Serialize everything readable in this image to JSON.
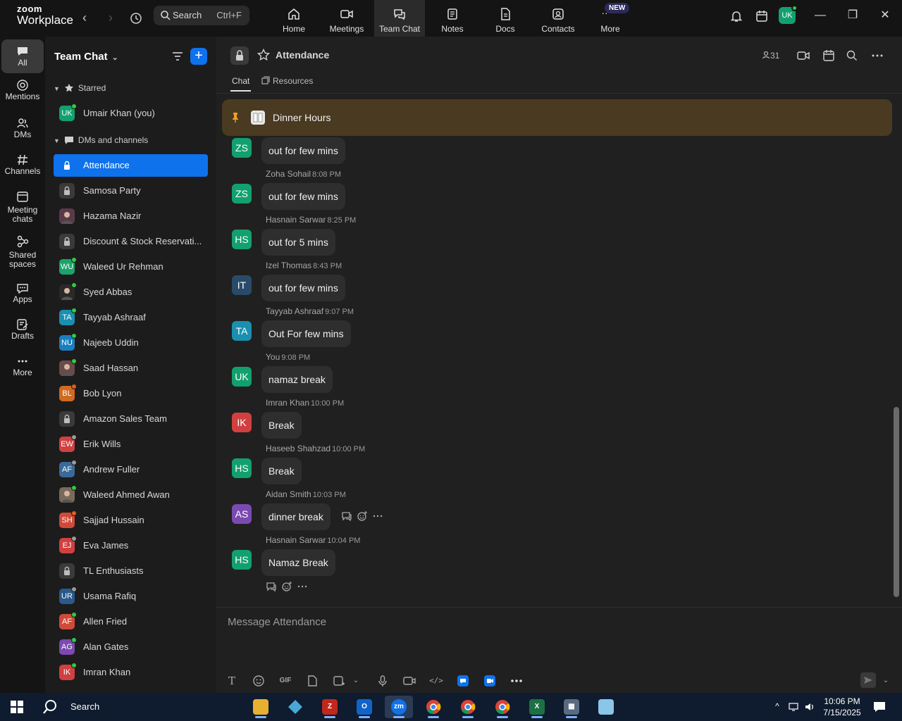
{
  "app": {
    "logo_top": "zoom",
    "logo_bottom": "Workplace"
  },
  "topbar": {
    "search_label": "Search",
    "search_shortcut": "Ctrl+F",
    "tabs": [
      {
        "label": "Home",
        "icon": "home-icon"
      },
      {
        "label": "Meetings",
        "icon": "video-icon"
      },
      {
        "label": "Team Chat",
        "icon": "chat-icon",
        "active": true
      },
      {
        "label": "Notes",
        "icon": "notes-icon"
      },
      {
        "label": "Docs",
        "icon": "docs-icon"
      },
      {
        "label": "Contacts",
        "icon": "contacts-icon"
      },
      {
        "label": "More",
        "icon": "more-icon"
      }
    ],
    "new_badge": "NEW",
    "user_initials": "UK"
  },
  "rail": {
    "items": [
      {
        "label": "All",
        "icon": "chat-bubble-icon",
        "active": true
      },
      {
        "label": "Mentions",
        "icon": "at-icon"
      },
      {
        "label": "DMs",
        "icon": "people-icon"
      },
      {
        "label": "Channels",
        "icon": "hash-icon"
      },
      {
        "label": "Meeting chats",
        "icon": "calendar-icon"
      },
      {
        "label": "Shared spaces",
        "icon": "shared-icon"
      },
      {
        "label": "Apps",
        "icon": "apps-icon"
      },
      {
        "label": "Drafts",
        "icon": "drafts-icon"
      },
      {
        "label": "More",
        "icon": "dots-icon"
      }
    ]
  },
  "sidebar": {
    "title": "Team Chat",
    "starred_label": "Starred",
    "dms_label": "DMs and channels",
    "starred": [
      {
        "initials": "UK",
        "name": "Umair Khan (you)",
        "color": "#12a06e",
        "status": "#2ecc40"
      }
    ],
    "items": [
      {
        "type": "lock",
        "name": "Attendance",
        "active": true
      },
      {
        "type": "lock",
        "name": "Samosa Party"
      },
      {
        "type": "photo",
        "name": "Hazama Nazir",
        "color": "#5a3a4a"
      },
      {
        "type": "lock",
        "name": "Discount & Stock Reservati..."
      },
      {
        "initials": "WU",
        "name": "Waleed Ur Rehman",
        "color": "#1aa36a",
        "status": "#2ecc40"
      },
      {
        "type": "photo",
        "name": "Syed Abbas",
        "color": "#2a2a2a",
        "status": "#2ecc40"
      },
      {
        "initials": "TA",
        "name": "Tayyab Ashraaf",
        "color": "#1a8fb0",
        "status": "#2ecc40"
      },
      {
        "initials": "NU",
        "name": "Najeeb Uddin",
        "color": "#1a7fc0",
        "status": "#2ecc40"
      },
      {
        "type": "photo",
        "name": "Saad Hassan",
        "color": "#6a4a4a",
        "status": "#2ecc40"
      },
      {
        "initials": "BL",
        "name": "Bob Lyon",
        "color": "#d06a20",
        "status": "#e65a1e"
      },
      {
        "type": "lock",
        "name": "Amazon Sales Team"
      },
      {
        "initials": "EW",
        "name": "Erik Wills",
        "color": "#d04040",
        "status": "#9a9a9a"
      },
      {
        "initials": "AF",
        "name": "Andrew Fuller",
        "color": "#3a6a9a",
        "status": "#9a9a9a"
      },
      {
        "type": "photo",
        "name": "Waleed Ahmed Awan",
        "color": "#7a6a5a",
        "status": "#2ecc40"
      },
      {
        "initials": "SH",
        "name": "Sajjad Hussain",
        "color": "#d04a3a",
        "status": "#e65a1e"
      },
      {
        "initials": "EJ",
        "name": "Eva James",
        "color": "#d04040",
        "status": "#9a9a9a"
      },
      {
        "type": "lock",
        "name": "TL Enthusiasts"
      },
      {
        "initials": "UR",
        "name": "Usama Rafiq",
        "color": "#2a5a8a",
        "status": "#9a9a9a"
      },
      {
        "initials": "AF",
        "name": "Allen Fried",
        "color": "#d04a3a",
        "status": "#2ecc40"
      },
      {
        "initials": "AG",
        "name": "Alan Gates",
        "color": "#7a4ab0",
        "status": "#2ecc40"
      },
      {
        "initials": "IK",
        "name": "Imran Khan",
        "color": "#d04040",
        "status": "#2ecc40"
      }
    ]
  },
  "channel": {
    "title": "Attendance",
    "member_count": "31",
    "tabs": [
      "Chat",
      "Resources"
    ],
    "pinned_text": "Dinner Hours",
    "messages": [
      {
        "initials": "ZS",
        "color": "#12a06e",
        "sender": "",
        "time": "",
        "text": "out for few mins"
      },
      {
        "initials": "ZS",
        "color": "#12a06e",
        "sender": "Zoha Sohail",
        "time": "8:08 PM",
        "text": "out for few mins"
      },
      {
        "initials": "HS",
        "color": "#12a06e",
        "sender": "Hasnain Sarwar",
        "time": "8:25 PM",
        "text": "out for 5 mins"
      },
      {
        "initials": "IT",
        "color": "#2a4a6a",
        "sender": "Izel Thomas",
        "time": "8:43 PM",
        "text": "out for few mins"
      },
      {
        "initials": "TA",
        "color": "#1a8fb0",
        "sender": "Tayyab Ashraaf",
        "time": "9:07 PM",
        "text": "Out For few mins"
      },
      {
        "initials": "UK",
        "color": "#12a06e",
        "sender": "You",
        "time": "9:08 PM",
        "text": "namaz break"
      },
      {
        "initials": "IK",
        "color": "#d04040",
        "sender": "Imran Khan",
        "time": "10:00 PM",
        "text": "Break"
      },
      {
        "initials": "HS",
        "color": "#12a06e",
        "sender": "Haseeb Shahzad",
        "time": "10:00 PM",
        "text": "Break"
      },
      {
        "initials": "AS",
        "color": "#7a4ab0",
        "sender": "Aidan Smith",
        "time": "10:03 PM",
        "text": "dinner break"
      },
      {
        "initials": "HS",
        "color": "#12a06e",
        "sender": "Hasnain Sarwar",
        "time": "10:04 PM",
        "text": "Namaz Break"
      }
    ],
    "composer_placeholder": "Message Attendance",
    "gif_label": "GIF"
  },
  "taskbar": {
    "search_label": "Search",
    "time": "10:06 PM",
    "date": "7/15/2025"
  }
}
